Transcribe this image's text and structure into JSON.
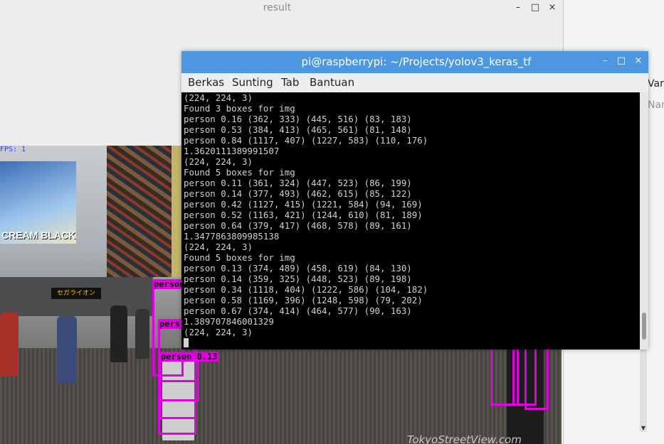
{
  "result_window": {
    "title": "result",
    "controls": {
      "minimize": "–",
      "maximize": "□",
      "close": "×"
    },
    "image": {
      "corner_label": "FPS: 1",
      "billboard_text": "CREAM BLACK",
      "shop_sign": "セガライオン",
      "watermark": "TokyoStreetView.com",
      "detections": [
        {
          "label": "person"
        },
        {
          "label": "pers"
        },
        {
          "label": "person 0.13"
        }
      ]
    }
  },
  "right_app": {
    "menu_item": "Var",
    "menu_item2": "Nar"
  },
  "terminal": {
    "title": "pi@raspberrypi: ~/Projects/yolov3_keras_tf",
    "controls": {
      "minimize": "–",
      "maximize": "□",
      "close": "×"
    },
    "menu": [
      "Berkas",
      "Sunting",
      "Tab",
      "Bantuan"
    ],
    "output_lines": [
      "(224, 224, 3)",
      "Found 3 boxes for img",
      "person 0.16 (362, 333) (445, 516) (83, 183)",
      "person 0.53 (384, 413) (465, 561) (81, 148)",
      "person 0.84 (1117, 407) (1227, 583) (110, 176)",
      "1.3620111389991507",
      "(224, 224, 3)",
      "Found 5 boxes for img",
      "person 0.11 (361, 324) (447, 523) (86, 199)",
      "person 0.14 (377, 493) (462, 615) (85, 122)",
      "person 0.42 (1127, 415) (1221, 584) (94, 169)",
      "person 0.52 (1163, 421) (1244, 610) (81, 189)",
      "person 0.64 (379, 417) (468, 578) (89, 161)",
      "1.3477863809985138",
      "(224, 224, 3)",
      "Found 5 boxes for img",
      "person 0.13 (374, 489) (458, 619) (84, 130)",
      "person 0.14 (359, 325) (448, 523) (89, 198)",
      "person 0.34 (1118, 404) (1222, 586) (104, 182)",
      "person 0.58 (1169, 396) (1248, 598) (79, 202)",
      "person 0.67 (374, 414) (464, 577) (90, 163)",
      "1.389707846001329",
      "(224, 224, 3)"
    ]
  },
  "colors": {
    "terminal_titlebar": "#4d97e1",
    "bbox": "#e000e0",
    "terminal_bg": "#000000",
    "terminal_fg": "#d0d0d0"
  }
}
